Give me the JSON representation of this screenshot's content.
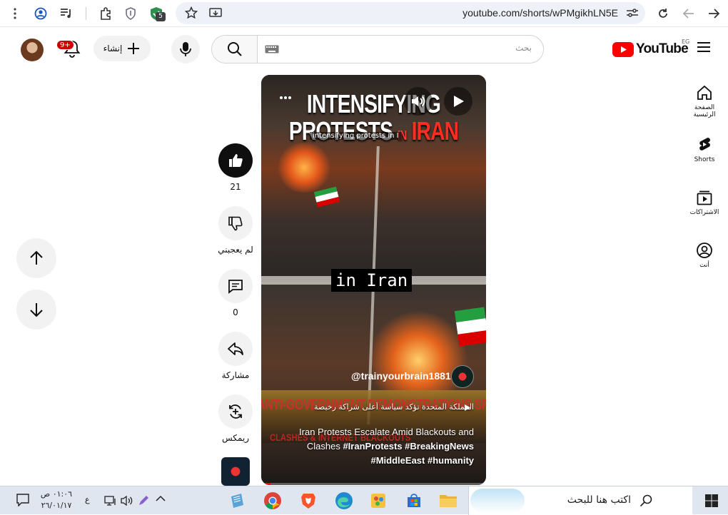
{
  "browser": {
    "url": "youtube.com/shorts/wPMgikhLN5E",
    "extension_badge": "5"
  },
  "header": {
    "logo_text": "YouTube",
    "region": "EG",
    "search_placeholder": "بحث",
    "create_label": "إنشاء",
    "notifications_badge": "9+"
  },
  "guide": {
    "items": [
      {
        "label": "الصفحة الرئيسية",
        "icon": "home-icon"
      },
      {
        "label": "Shorts",
        "icon": "shorts-icon"
      },
      {
        "label": "الاشتراكات",
        "icon": "subscriptions-icon"
      },
      {
        "label": "أنت",
        "icon": "you-icon"
      }
    ]
  },
  "actions": {
    "like_count": "21",
    "dislike_label": "لم يعجبني",
    "comment_count": "0",
    "share_label": "مشاركة",
    "remix_label": "ريمكس"
  },
  "video": {
    "title_line1": "INTENSIFYING",
    "title_line2_a": "PROTESTS",
    "title_line2_b": "IN",
    "title_line2_c": "IRAN",
    "small_overlay": "intensifying protests in I",
    "caption": "in Iran",
    "banner_line1": "ANTI-GOVERNMENT DEMONSTRATIONS SPREAD",
    "banner_line2": "CLASHES & INTERNET BLACKOUTS",
    "channel": "@trainyourbrain1881",
    "music": "المملكة المتحدة تؤكد سياسة أعلى شراكة رخيصة",
    "description_plain": "Iran Protests Escalate Amid Blackouts and Clashes ",
    "hashtags": [
      "#IranProtests",
      "#BreakingNews",
      "#MiddleEast",
      "#humanity"
    ],
    "progress": 0.04
  },
  "taskbar": {
    "search_placeholder": "اكتب هنا للبحث",
    "time": "٠١:٠٦ ص",
    "date": "٢٦/٠١/١٧",
    "lang": "ع"
  },
  "colors": {
    "youtube_red": "#ff0000",
    "like_active": "#0f0f0f",
    "taskbar": "#dfe6ef"
  }
}
